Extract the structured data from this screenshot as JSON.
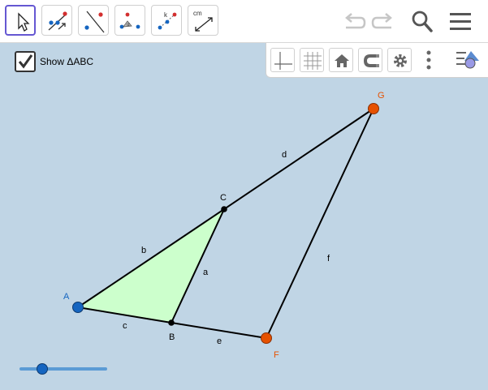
{
  "toolbar": {
    "tools": [
      {
        "name": "move-tool",
        "active": true
      },
      {
        "name": "point-tool",
        "active": false
      },
      {
        "name": "line-tool",
        "active": false
      },
      {
        "name": "angle-tool",
        "active": false
      },
      {
        "name": "slider-tool",
        "label": "k",
        "active": false
      },
      {
        "name": "distance-tool",
        "label": "cm",
        "active": false
      }
    ],
    "icons": [
      "undo-icon",
      "redo-icon",
      "search-icon",
      "menu-icon"
    ]
  },
  "style_bar": {
    "buttons": [
      "axes-icon",
      "grid-icon",
      "home-icon",
      "magnet-icon",
      "gear-icon",
      "more-icon",
      "style-icon"
    ]
  },
  "checkbox": {
    "label": "Show ΔABC",
    "checked": true
  },
  "construction": {
    "points": {
      "A": {
        "label": "A",
        "color": "#1565c0"
      },
      "B": {
        "label": "B",
        "color": "#000000"
      },
      "C": {
        "label": "C",
        "color": "#000000"
      },
      "F": {
        "label": "F",
        "color": "#e65100"
      },
      "G": {
        "label": "G",
        "color": "#e65100"
      }
    },
    "segments": {
      "a": "a",
      "b": "b",
      "c": "c",
      "d": "d",
      "e": "e",
      "f": "f"
    },
    "triangle_fill": "#ccffcc"
  },
  "slider": {
    "value": 0.25,
    "color": "#5b9bd5"
  },
  "colors": {
    "canvas_bg": "#c0d5e5",
    "accent": "#6557d2",
    "free_point": "#e65100"
  }
}
